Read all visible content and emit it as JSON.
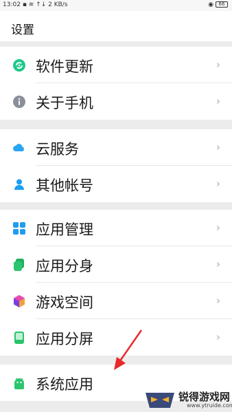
{
  "status_bar": {
    "time": "13:02",
    "network_speed": "2 KB/s",
    "battery": "66"
  },
  "header": {
    "title": "设置"
  },
  "groups": [
    {
      "items": [
        {
          "label": "软件更新",
          "icon": "refresh-icon",
          "icon_color": "#1ec98a"
        },
        {
          "label": "关于手机",
          "icon": "info-icon",
          "icon_color": "#8a8f99"
        }
      ]
    },
    {
      "items": [
        {
          "label": "云服务",
          "icon": "cloud-icon",
          "icon_color": "#2aa6f2"
        },
        {
          "label": "其他帐号",
          "icon": "person-icon",
          "icon_color": "#1a9ef0"
        }
      ]
    },
    {
      "items": [
        {
          "label": "应用管理",
          "icon": "grid-icon",
          "icon_color": "#1f9cf0"
        },
        {
          "label": "应用分身",
          "icon": "clone-icon",
          "icon_color": "#2cc56f"
        },
        {
          "label": "游戏空间",
          "icon": "game-cube-icon",
          "icon_color": "#7a3fe0"
        },
        {
          "label": "应用分屏",
          "icon": "split-screen-icon",
          "icon_color": "#27c46b"
        }
      ]
    },
    {
      "items": [
        {
          "label": "系统应用",
          "icon": "android-icon",
          "icon_color": "#2cc56f"
        }
      ]
    }
  ],
  "watermark": {
    "text": "锐得游戏网",
    "url": "www.ytruide.com"
  },
  "colors": {
    "annotation_arrow": "#e8282b",
    "background": "#ececec",
    "chevron": "#aaaaaa"
  }
}
